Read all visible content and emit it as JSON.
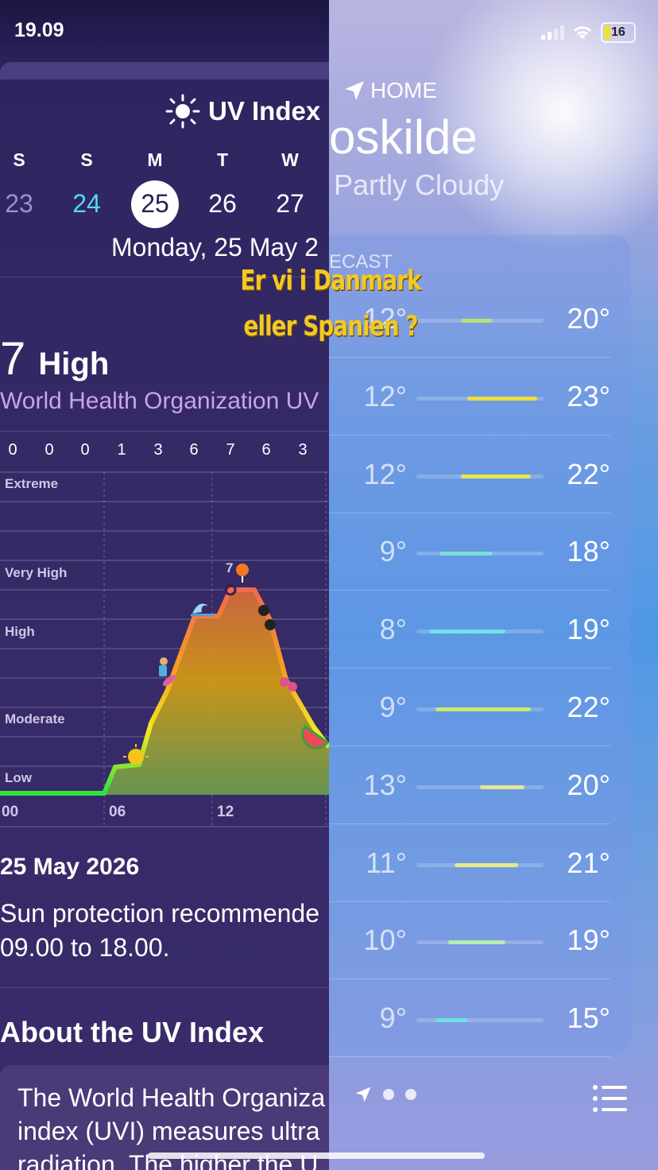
{
  "status_bar": {
    "time": "19.09",
    "battery": "16"
  },
  "uv_app": {
    "title": "UV Index",
    "days": [
      {
        "letter": "S",
        "num": "23"
      },
      {
        "letter": "S",
        "num": "24"
      },
      {
        "letter": "M",
        "num": "25"
      },
      {
        "letter": "T",
        "num": "26"
      },
      {
        "letter": "W",
        "num": "27"
      }
    ],
    "selected_date": "Monday, 25 May 2",
    "uv_value": "7",
    "uv_level": "High",
    "source": "World Health Organization UV",
    "hourly": [
      "0",
      "0",
      "0",
      "1",
      "3",
      "6",
      "7",
      "6",
      "3"
    ],
    "levels": {
      "extreme": "Extreme",
      "very_high": "Very High",
      "high": "High",
      "moderate": "Moderate",
      "low": "Low"
    },
    "time_axis": [
      "00",
      "06",
      "12"
    ],
    "peak_label": "7",
    "footer_date": "25 May 2026",
    "protection_line1": "Sun protection recommende",
    "protection_line2": "09.00 to 18.00.",
    "about_title": "About the UV Index",
    "about_lines": [
      "The World Health Organiza",
      "index (UVI) measures ultra",
      "radiation. The higher the U"
    ]
  },
  "weather_app": {
    "location_label": "HOME",
    "city": "oskilde",
    "condition": "Partly Cloudy",
    "forecast_label": "ECAST",
    "rows": [
      {
        "low": "12°",
        "high": "20°",
        "bar_start": 0.35,
        "bar_end": 0.6,
        "color": "#b8e07a"
      },
      {
        "low": "12°",
        "high": "23°",
        "bar_start": 0.4,
        "bar_end": 0.95,
        "color": "#f0dc3a"
      },
      {
        "low": "12°",
        "high": "22°",
        "bar_start": 0.35,
        "bar_end": 0.9,
        "color": "#e8e64c"
      },
      {
        "low": "9°",
        "high": "18°",
        "bar_start": 0.18,
        "bar_end": 0.6,
        "color": "#7ae0d8"
      },
      {
        "low": "8°",
        "high": "19°",
        "bar_start": 0.1,
        "bar_end": 0.7,
        "color": "#6fe3e6"
      },
      {
        "low": "9°",
        "high": "22°",
        "bar_start": 0.15,
        "bar_end": 0.9,
        "color": "#c6ea6a"
      },
      {
        "low": "13°",
        "high": "20°",
        "bar_start": 0.5,
        "bar_end": 0.85,
        "color": "#e4e690"
      },
      {
        "low": "11°",
        "high": "21°",
        "bar_start": 0.3,
        "bar_end": 0.8,
        "color": "#e8ea8a"
      },
      {
        "low": "10°",
        "high": "19°",
        "bar_start": 0.25,
        "bar_end": 0.7,
        "color": "#b9ebb0"
      },
      {
        "low": "9°",
        "high": "15°",
        "bar_start": 0.15,
        "bar_end": 0.4,
        "color": "#6fe0e0"
      }
    ]
  },
  "overlay": {
    "line1": "Er vi i Danmark",
    "line2": "eller Spanien ?"
  }
}
